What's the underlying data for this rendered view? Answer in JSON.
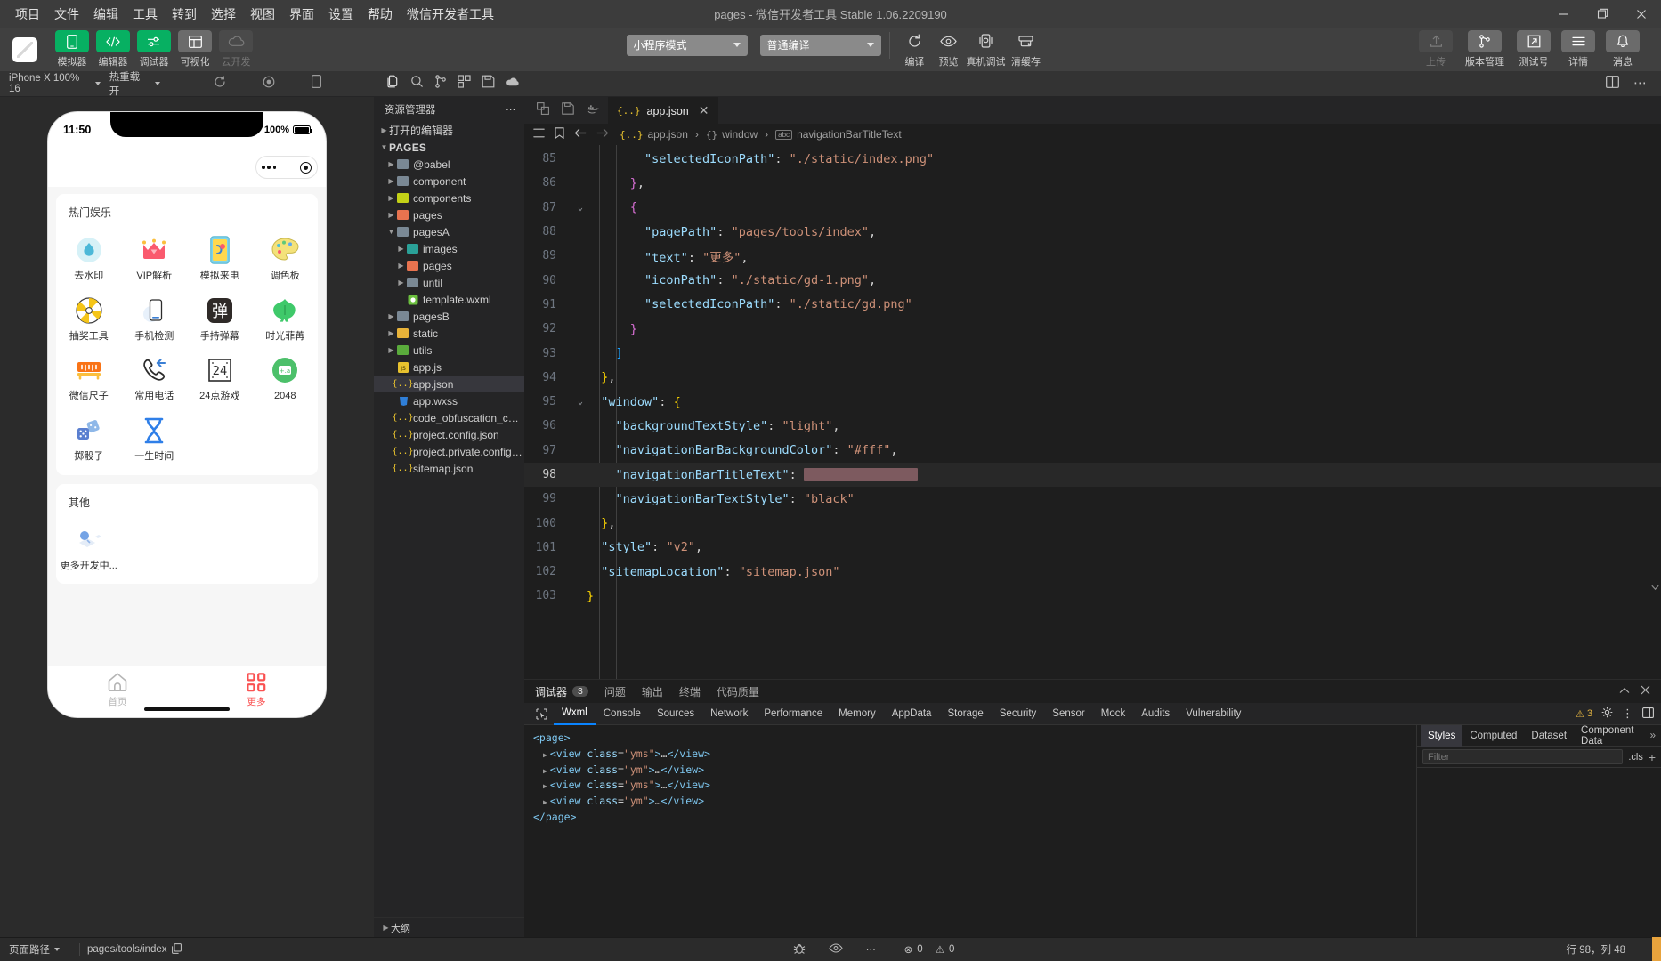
{
  "window": {
    "title": "pages - 微信开发者工具 Stable 1.06.2209190",
    "menu": [
      "项目",
      "文件",
      "编辑",
      "工具",
      "转到",
      "选择",
      "视图",
      "界面",
      "设置",
      "帮助",
      "微信开发者工具"
    ],
    "controls": {
      "minimize": "minimize-icon",
      "maximize": "restore-icon",
      "close": "close-icon"
    }
  },
  "toolbar": {
    "left_buttons": [
      {
        "label": "模拟器",
        "icon": "simulator-icon",
        "state": "active"
      },
      {
        "label": "编辑器",
        "icon": "code-icon",
        "state": "active"
      },
      {
        "label": "调试器",
        "icon": "debugger-icon",
        "state": "active"
      },
      {
        "label": "可视化",
        "icon": "layout-icon",
        "state": "inactive"
      },
      {
        "label": "云开发",
        "icon": "cloud-icon",
        "state": "disabled"
      }
    ],
    "mode_select": "小程序模式",
    "compile_select": "普通编译",
    "center_buttons": [
      {
        "label": "编译",
        "icon": "refresh-icon"
      },
      {
        "label": "预览",
        "icon": "eye-icon"
      },
      {
        "label": "真机调试",
        "icon": "device-debug-icon"
      },
      {
        "label": "清缓存",
        "icon": "cache-icon"
      }
    ],
    "right_buttons": [
      {
        "label": "上传",
        "icon": "upload-icon",
        "state": "disabled"
      },
      {
        "label": "版本管理",
        "icon": "branch-icon",
        "state": "normal"
      },
      {
        "label": "测试号",
        "icon": "external-icon",
        "state": "normal"
      },
      {
        "label": "详情",
        "icon": "menu-icon",
        "state": "normal"
      },
      {
        "label": "消息",
        "icon": "bell-icon",
        "state": "normal"
      }
    ]
  },
  "subbar": {
    "device": "iPhone X 100% 16",
    "hot_reload": "热重载 开"
  },
  "simulator": {
    "status_time": "11:50",
    "status_battery": "100%",
    "capsule": {
      "more": "more-dots-icon",
      "target": "target-icon"
    },
    "sections": [
      {
        "title": "热门娱乐",
        "items": [
          {
            "label": "去水印",
            "icon": "watermark-icon"
          },
          {
            "label": "VIP解析",
            "icon": "crown-icon"
          },
          {
            "label": "模拟来电",
            "icon": "fake-call-icon"
          },
          {
            "label": "调色板",
            "icon": "palette-icon"
          },
          {
            "label": "抽奖工具",
            "icon": "lottery-wheel-icon"
          },
          {
            "label": "手机检测",
            "icon": "phone-check-icon"
          },
          {
            "label": "手持弹幕",
            "icon": "danmu-icon"
          },
          {
            "label": "时光菲苒",
            "icon": "leaf-icon"
          },
          {
            "label": "微信尺子",
            "icon": "ruler-icon"
          },
          {
            "label": "常用电话",
            "icon": "phone-icon"
          },
          {
            "label": "24点游戏",
            "icon": "card24-icon"
          },
          {
            "label": "2048",
            "icon": "game2048-icon"
          },
          {
            "label": "掷骰子",
            "icon": "dice-icon"
          },
          {
            "label": "一生时间",
            "icon": "hourglass-icon"
          }
        ]
      },
      {
        "title": "其他",
        "items": [
          {
            "label": "更多开发中...",
            "icon": "dev-icon"
          }
        ]
      }
    ],
    "tabbar": [
      {
        "label": "首页",
        "icon": "home-icon",
        "active": false
      },
      {
        "label": "更多",
        "icon": "grid-icon",
        "active": true
      }
    ]
  },
  "explorer": {
    "icons": [
      "files-icon",
      "search-icon",
      "source-control-icon",
      "extensions-icon",
      "save-all-icon",
      "cloud-dev-icon"
    ],
    "header": "资源管理器",
    "header_more": "ellipsis-icon",
    "open_editors": "打开的编辑器",
    "root": "PAGES",
    "tree": [
      {
        "name": "@babel",
        "type": "folder",
        "depth": 1,
        "color": "#7a8894"
      },
      {
        "name": "component",
        "type": "folder",
        "depth": 1,
        "color": "#7a8894"
      },
      {
        "name": "components",
        "type": "folder",
        "depth": 1,
        "color": "#c3d117"
      },
      {
        "name": "pages",
        "type": "folder",
        "depth": 1,
        "color": "#e8734f"
      },
      {
        "name": "pagesA",
        "type": "folder-open",
        "depth": 1,
        "color": "#7a8894"
      },
      {
        "name": "images",
        "type": "folder",
        "depth": 2,
        "color": "#2aa198"
      },
      {
        "name": "pages",
        "type": "folder",
        "depth": 2,
        "color": "#e8734f"
      },
      {
        "name": "until",
        "type": "folder",
        "depth": 2,
        "color": "#7a8894"
      },
      {
        "name": "template.wxml",
        "type": "file-wxml",
        "depth": 2,
        "color": "#6bbf3e"
      },
      {
        "name": "pagesB",
        "type": "folder",
        "depth": 1,
        "color": "#7a8894"
      },
      {
        "name": "static",
        "type": "folder",
        "depth": 1,
        "color": "#e8b339"
      },
      {
        "name": "utils",
        "type": "folder",
        "depth": 1,
        "color": "#5aab3c"
      },
      {
        "name": "app.js",
        "type": "file-js",
        "depth": 1,
        "color": "#e8c22e"
      },
      {
        "name": "app.json",
        "type": "file-json",
        "depth": 1,
        "color": "#e8c22e",
        "selected": true
      },
      {
        "name": "app.wxss",
        "type": "file-wxss",
        "depth": 1,
        "color": "#2f7fd8"
      },
      {
        "name": "code_obfuscation_conf...",
        "type": "file-json",
        "depth": 1,
        "color": "#e8c22e"
      },
      {
        "name": "project.config.json",
        "type": "file-json",
        "depth": 1,
        "color": "#e8c22e"
      },
      {
        "name": "project.private.config.js...",
        "type": "file-json",
        "depth": 1,
        "color": "#e8c22e"
      },
      {
        "name": "sitemap.json",
        "type": "file-json",
        "depth": 1,
        "color": "#e8c22e"
      }
    ],
    "outline": "大纲"
  },
  "editor": {
    "tab": {
      "label": "app.json",
      "icon": "json-icon",
      "close": "close-icon"
    },
    "tab_icons": [
      "split-icon",
      "save-icon",
      "docker-icon"
    ],
    "breadcrumb_icons": [
      "outline-icon",
      "bookmark-icon",
      "back-icon",
      "forward-icon"
    ],
    "breadcrumb": [
      "app.json",
      "window",
      "navigationBarTitleText"
    ],
    "lines": [
      {
        "n": 85,
        "html": "        <span class='k'>\"selectedIconPath\"</span><span class='p'>:</span> <span class='s'>\"./static/index.png\"</span>"
      },
      {
        "n": 86,
        "html": "      <span class='b2'>}</span><span class='p'>,</span>"
      },
      {
        "n": 87,
        "fold": true,
        "html": "      <span class='b2'>{</span>"
      },
      {
        "n": 88,
        "html": "        <span class='k'>\"pagePath\"</span><span class='p'>:</span> <span class='s'>\"pages/tools/index\"</span><span class='p'>,</span>"
      },
      {
        "n": 89,
        "html": "        <span class='k'>\"text\"</span><span class='p'>:</span> <span class='s'>\"更多\"</span><span class='p'>,</span>"
      },
      {
        "n": 90,
        "html": "        <span class='k'>\"iconPath\"</span><span class='p'>:</span> <span class='s'>\"./static/gd-1.png\"</span><span class='p'>,</span>"
      },
      {
        "n": 91,
        "html": "        <span class='k'>\"selectedIconPath\"</span><span class='p'>:</span> <span class='s'>\"./static/gd.png\"</span>"
      },
      {
        "n": 92,
        "html": "      <span class='b2'>}</span>"
      },
      {
        "n": 93,
        "html": "    <span class='b3'>]</span>"
      },
      {
        "n": 94,
        "html": "  <span class='b1'>}</span><span class='p'>,</span>"
      },
      {
        "n": 95,
        "fold": true,
        "html": "  <span class='k'>\"window\"</span><span class='p'>:</span> <span class='b1'>{</span>"
      },
      {
        "n": 96,
        "html": "    <span class='k'>\"backgroundTextStyle\"</span><span class='p'>:</span> <span class='s'>\"light\"</span><span class='p'>,</span>"
      },
      {
        "n": 97,
        "html": "    <span class='k'>\"navigationBarBackgroundColor\"</span><span class='p'>:</span> <span class='s'>\"#fff\"</span><span class='p'>,</span>"
      },
      {
        "n": 98,
        "hl": true,
        "html": "    <span class='k'>\"navigationBarTitleText\"</span><span class='p'>:</span> <span class='redact'></span>"
      },
      {
        "n": 99,
        "html": "    <span class='k'>\"navigationBarTextStyle\"</span><span class='p'>:</span> <span class='s'>\"black\"</span>"
      },
      {
        "n": 100,
        "html": "  <span class='b1'>}</span><span class='p'>,</span>"
      },
      {
        "n": 101,
        "html": "  <span class='k'>\"style\"</span><span class='p'>:</span> <span class='s'>\"v2\"</span><span class='p'>,</span>"
      },
      {
        "n": 102,
        "html": "  <span class='k'>\"sitemapLocation\"</span><span class='p'>:</span> <span class='s'>\"sitemap.json\"</span>"
      },
      {
        "n": 103,
        "html": "<span class='b1'>}</span>"
      }
    ]
  },
  "debugger": {
    "panel_tabs": [
      {
        "label": "调试器",
        "badge": "3",
        "active": true
      },
      {
        "label": "问题",
        "active": false
      },
      {
        "label": "输出",
        "active": false
      },
      {
        "label": "终端",
        "active": false
      },
      {
        "label": "代码质量",
        "active": false
      }
    ],
    "panel_right_icons": [
      "chevron-up-icon",
      "close-icon"
    ],
    "devtools_tabs": [
      "Wxml",
      "Console",
      "Sources",
      "Network",
      "Performance",
      "Memory",
      "AppData",
      "Storage",
      "Security",
      "Sensor",
      "Mock",
      "Audits",
      "Vulnerability"
    ],
    "devtools_active": "Wxml",
    "inspect_icon": "inspect-icon",
    "warning_count": "3",
    "right_icons": [
      "gear-icon",
      "kebab-icon",
      "dock-icon"
    ],
    "wxml": [
      {
        "indent": 0,
        "html": "<span class='wx-tag'>&lt;page&gt;</span>",
        "arrow": false
      },
      {
        "indent": 1,
        "html": "<span class='wx-tag'>&lt;view</span> <span class='wx-attr'>class</span>=<span class='wx-val'>\"yms\"</span><span class='wx-tag'>&gt;</span>…<span class='wx-tag'>&lt;/view&gt;</span>",
        "arrow": true
      },
      {
        "indent": 1,
        "html": "<span class='wx-tag'>&lt;view</span> <span class='wx-attr'>class</span>=<span class='wx-val'>\"ym\"</span><span class='wx-tag'>&gt;</span>…<span class='wx-tag'>&lt;/view&gt;</span>",
        "arrow": true
      },
      {
        "indent": 1,
        "html": "<span class='wx-tag'>&lt;view</span> <span class='wx-attr'>class</span>=<span class='wx-val'>\"yms\"</span><span class='wx-tag'>&gt;</span>…<span class='wx-tag'>&lt;/view&gt;</span>",
        "arrow": true
      },
      {
        "indent": 1,
        "html": "<span class='wx-tag'>&lt;view</span> <span class='wx-attr'>class</span>=<span class='wx-val'>\"ym\"</span><span class='wx-tag'>&gt;</span>…<span class='wx-tag'>&lt;/view&gt;</span>",
        "arrow": true
      },
      {
        "indent": 0,
        "html": "<span class='wx-tag'>&lt;/page&gt;</span>",
        "arrow": false
      }
    ],
    "styles_tabs": [
      "Styles",
      "Computed",
      "Dataset",
      "Component Data"
    ],
    "styles_active": "Styles",
    "filter_placeholder": "Filter",
    "cls_label": ".cls",
    "add_rule": "add-icon",
    "expand": "chevron-right-icon"
  },
  "statusbar": {
    "page_path_label": "页面路径",
    "page_path": "pages/tools/index",
    "copy_icon": "copy-icon",
    "errors": "0",
    "warnings": "0",
    "icons": [
      "bug-icon",
      "eye-icon",
      "ellipsis-icon"
    ],
    "cursor": "行 98，列 48"
  },
  "colors": {
    "accent_green": "#07b062",
    "accent_blue": "#0a84ff",
    "chrome": "#3c3c3c",
    "editor_bg": "#1e1e1e",
    "sidebar_bg": "#252526",
    "tab_red": "#fa5151"
  }
}
